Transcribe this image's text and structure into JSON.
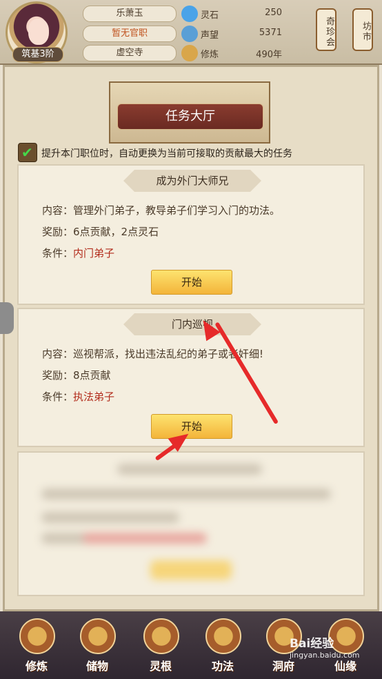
{
  "player": {
    "name": "乐萧玉",
    "position": "暂无官职",
    "sect": "虚空寺",
    "rank": "筑基3阶"
  },
  "stats": [
    {
      "label": "灵石",
      "value": "250",
      "icon": "spirit-stone-icon",
      "color": "#4aa3e8"
    },
    {
      "label": "声望",
      "value": "5371",
      "icon": "reputation-icon",
      "color": "#5a9fd6"
    },
    {
      "label": "修炼",
      "value": "490年",
      "icon": "meditation-icon",
      "color": "#d9a64a"
    }
  ],
  "side_tabs": {
    "treasure": "奇珍会",
    "market": "坊市"
  },
  "page_title": "任务大厅",
  "auto_option": {
    "checked": true,
    "text": "提升本门职位时，自动更换为当前可接取的贡献最大的任务"
  },
  "tasks": [
    {
      "title": "成为外门大师兄",
      "content_label": "内容：",
      "content": "管理外门弟子，教导弟子们学习入门的功法。",
      "reward_label": "奖励：",
      "reward": "6点贡献，2点灵石",
      "condition_label": "条件：",
      "condition": "内门弟子",
      "button": "开始"
    },
    {
      "title": "门内巡视",
      "content_label": "内容：",
      "content": "巡视帮派，找出违法乱纪的弟子或者奸细!",
      "reward_label": "奖励：",
      "reward": "8点贡献",
      "condition_label": "条件：",
      "condition": "执法弟子",
      "button": "开始"
    }
  ],
  "nav": [
    {
      "label": "修炼",
      "icon": "cultivation-icon"
    },
    {
      "label": "储物",
      "icon": "storage-bag-icon"
    },
    {
      "label": "灵根",
      "icon": "spirit-root-icon"
    },
    {
      "label": "功法",
      "icon": "technique-book-icon"
    },
    {
      "label": "洞府",
      "icon": "cave-dwelling-icon"
    },
    {
      "label": "仙缘",
      "icon": "immortal-fate-icon"
    }
  ],
  "watermark": {
    "text": "Bai经验",
    "sub": "jingyan.baidu.com"
  }
}
